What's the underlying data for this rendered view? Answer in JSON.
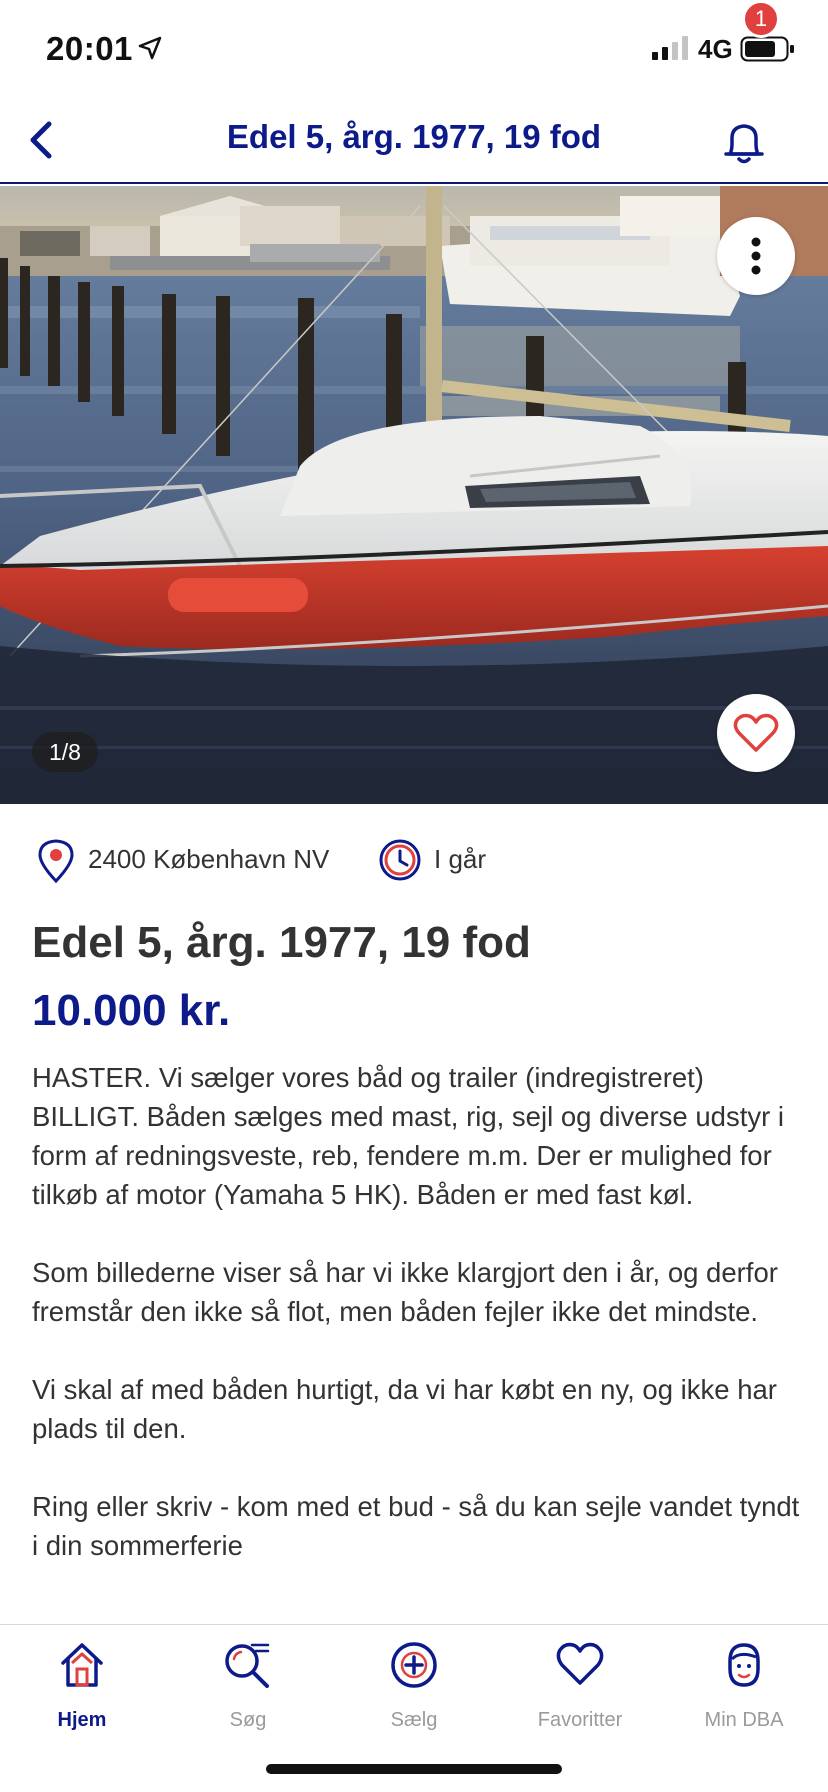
{
  "status_bar": {
    "time": "20:01",
    "network": "4G",
    "icons": [
      "location-arrow-icon",
      "signal-icon",
      "battery-icon"
    ]
  },
  "header": {
    "title": "Edel 5, årg. 1977, 19 fod",
    "notification_count": "1",
    "icons": [
      "back-chevron-icon",
      "bell-icon"
    ]
  },
  "gallery": {
    "counter": "1/8",
    "icons": [
      "more-vertical-icon",
      "heart-icon"
    ]
  },
  "listing": {
    "location": "2400 København NV",
    "posted": "I går",
    "title": "Edel 5, årg. 1977, 19 fod",
    "price": "10.000 kr.",
    "description": [
      "HASTER. Vi sælger vores båd og trailer (indregistreret) BILLIGT.  Båden sælges med mast, rig, sejl og diverse udstyr i form af redningsveste, reb, fendere m.m. Der er mulighed for tilkøb af motor (Yamaha 5 HK). Båden er med fast køl.",
      "Som billederne viser så har vi ikke klargjort den i år, og derfor fremstår den ikke så flot, men båden fejler ikke det mindste.",
      "Vi skal af med båden hurtigt, da vi har købt en ny, og ikke har plads til den.",
      "Ring eller skriv  - kom med et bud - så du kan sejle vandet tyndt i din sommerferie"
    ]
  },
  "bottom_nav": {
    "items": [
      {
        "label": "Hjem",
        "icon": "home-icon",
        "active": true
      },
      {
        "label": "Søg",
        "icon": "search-icon",
        "active": false
      },
      {
        "label": "Sælg",
        "icon": "plus-circle-icon",
        "active": false
      },
      {
        "label": "Favoritter",
        "icon": "heart-outline-icon",
        "active": false
      },
      {
        "label": "Min DBA",
        "icon": "profile-icon",
        "active": false
      }
    ]
  },
  "colors": {
    "brand_navy": "#0c1a8a",
    "badge_red": "#e0413e",
    "heart_red": "#e0413e",
    "hull_red": "#c9332a"
  }
}
